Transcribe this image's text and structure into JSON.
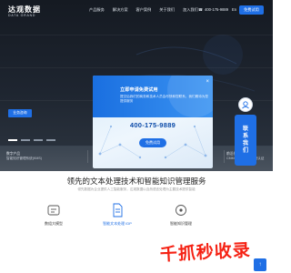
{
  "brand": {
    "name_cn": "达观数据",
    "name_en": "DATA GRAND"
  },
  "nav": {
    "items": [
      "产品服务",
      "解决方案",
      "客户案例",
      "关于我们",
      "加入我们"
    ]
  },
  "header": {
    "phone": "400-175-9889",
    "lang": "En",
    "trial_label": "免费试用"
  },
  "hero": {
    "button_label": "业务咨询",
    "slides_total": 4,
    "slides_active": 1
  },
  "strip": {
    "left_title": "数字产品",
    "left_sub": "智能知识管理系统(KMS)",
    "right_title": "前沿技术",
    "right_sub": "CMMI5级 软件成熟度认证"
  },
  "modal": {
    "title": "立即申请免费试用",
    "description": "提交后我们的商务和技术人员会尽快和您联系，我们期待为您提供服务",
    "phone": "400-175-9889",
    "button_label": "免费试用"
  },
  "side": {
    "label_lines": [
      "联",
      "系",
      "我",
      "们"
    ]
  },
  "section": {
    "title": "领先的文本处理技术和智能知识管理服务",
    "subtitle": "领先数据为企业提供人工智能服务，达观数据以自然语言处理为主要技术提供智能",
    "features": [
      {
        "label": "数组大模型",
        "active": false
      },
      {
        "label": "智能文本处理 IDP",
        "active": true
      },
      {
        "label": "智能知识管理",
        "active": false
      }
    ]
  },
  "watermark": {
    "text": "千抓秒收录"
  },
  "colors": {
    "accent": "#1f6fe5",
    "dark": "#1a2029",
    "watermark": "#f52214"
  }
}
